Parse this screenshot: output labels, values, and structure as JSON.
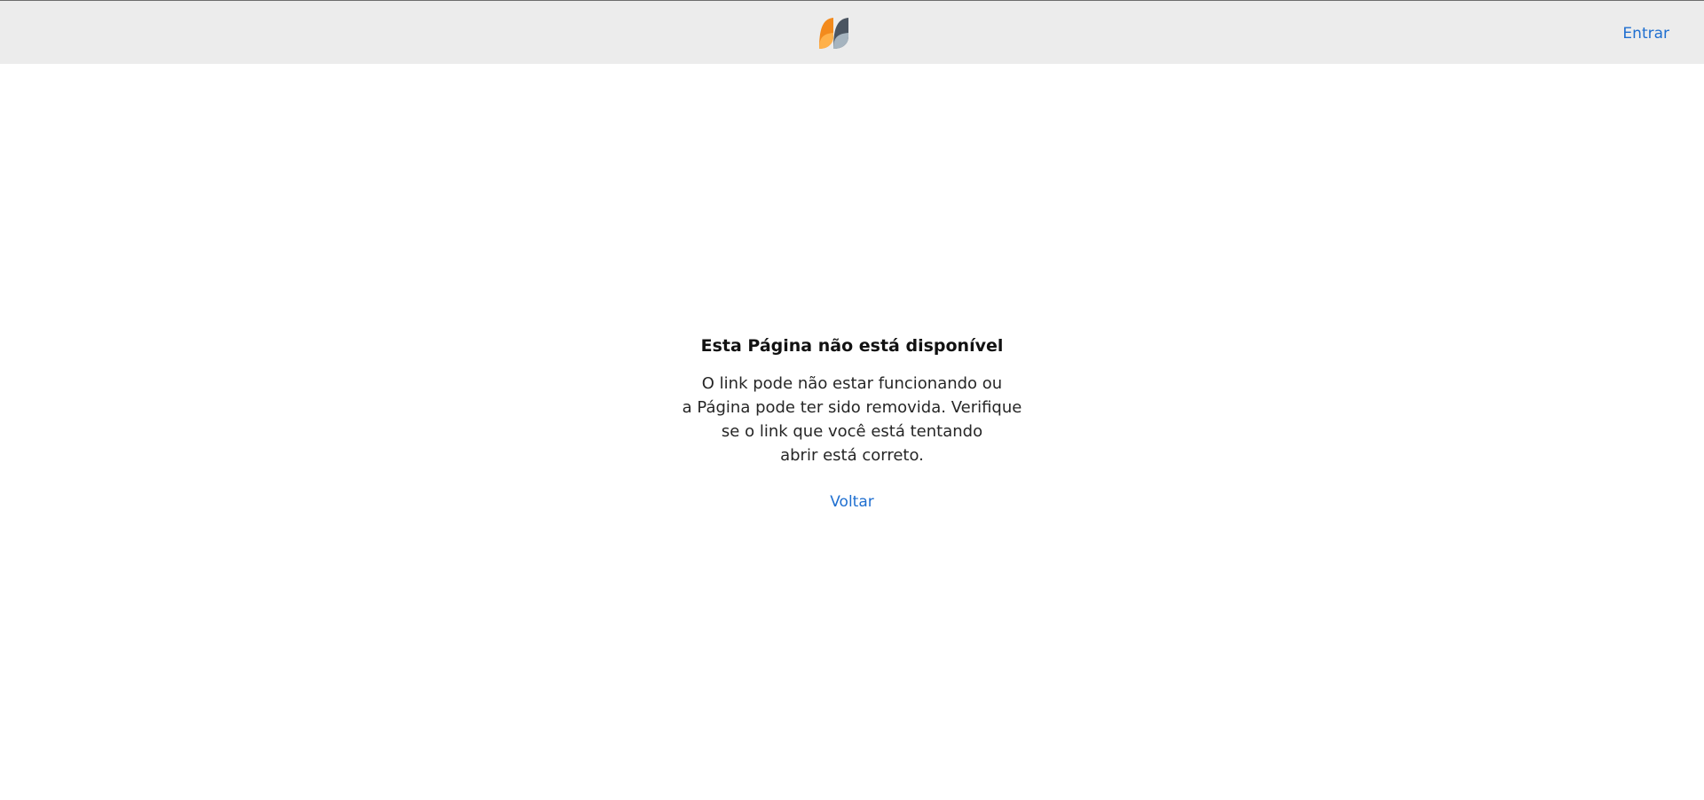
{
  "header": {
    "logo_icon": "brand-leaf-logo-icon",
    "sign_in_label": "Entrar",
    "accent_color": "#1f6fd0",
    "logo_colors": {
      "orange_dark": "#f38a1c",
      "orange_light": "#ffb14a",
      "slate_dark": "#4b5561",
      "slate_light": "#a6b4bf"
    }
  },
  "error_page": {
    "title": "Esta Página não está disponível",
    "message_lines": [
      "O link pode não estar funcionando ou",
      "a Página pode ter sido removida. Verifique",
      "se o link que você está tentando",
      "abrir está correto."
    ],
    "back_label": "Voltar"
  }
}
